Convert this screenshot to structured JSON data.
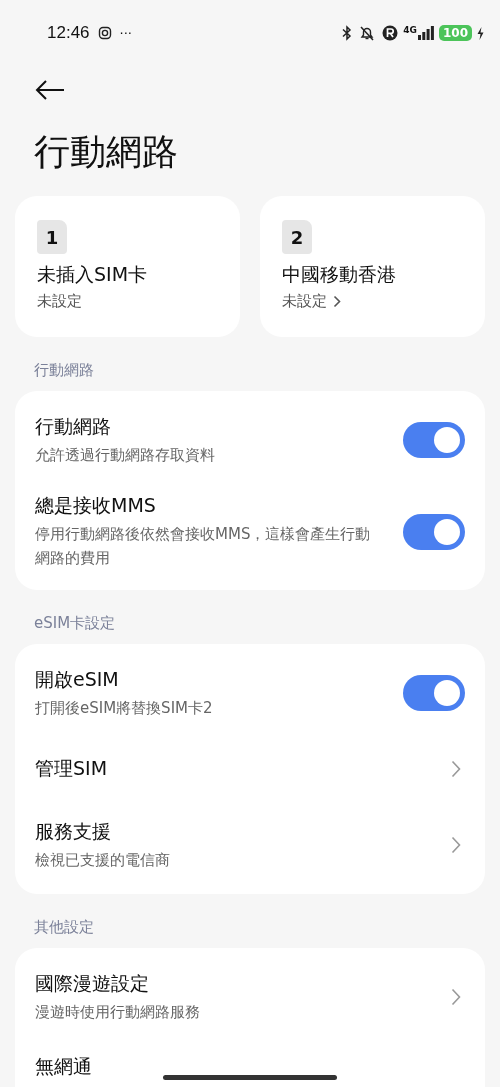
{
  "status_bar": {
    "time": "12:46",
    "more": "···",
    "network": "4G",
    "battery": "100"
  },
  "title": "行動網路",
  "sim_cards": [
    {
      "slot": "1",
      "name": "未插入SIM卡",
      "status": "未設定",
      "chevron": false
    },
    {
      "slot": "2",
      "name": "中國移動香港",
      "status": "未設定",
      "chevron": true
    }
  ],
  "sections": [
    {
      "header": "行動網路",
      "rows": [
        {
          "kind": "toggle",
          "title": "行動網路",
          "subtitle": "允許透過行動網路存取資料",
          "on": true
        },
        {
          "kind": "toggle",
          "title": "總是接收MMS",
          "subtitle": "停用行動網路後依然會接收MMS，這樣會產生行動網路的費用",
          "on": true
        }
      ]
    },
    {
      "header": "eSIM卡設定",
      "rows": [
        {
          "kind": "toggle",
          "title": "開啟eSIM",
          "subtitle": "打開後eSIM將替換SIM卡2",
          "on": true
        },
        {
          "kind": "link",
          "title": "管理SIM"
        },
        {
          "kind": "link",
          "title": "服務支援",
          "subtitle": "檢視已支援的電信商"
        }
      ]
    },
    {
      "header": "其他設定",
      "rows": [
        {
          "kind": "link",
          "title": "國際漫遊設定",
          "subtitle": "漫遊時使用行動網路服務"
        },
        {
          "kind": "plain",
          "title": "無網通"
        }
      ]
    }
  ]
}
